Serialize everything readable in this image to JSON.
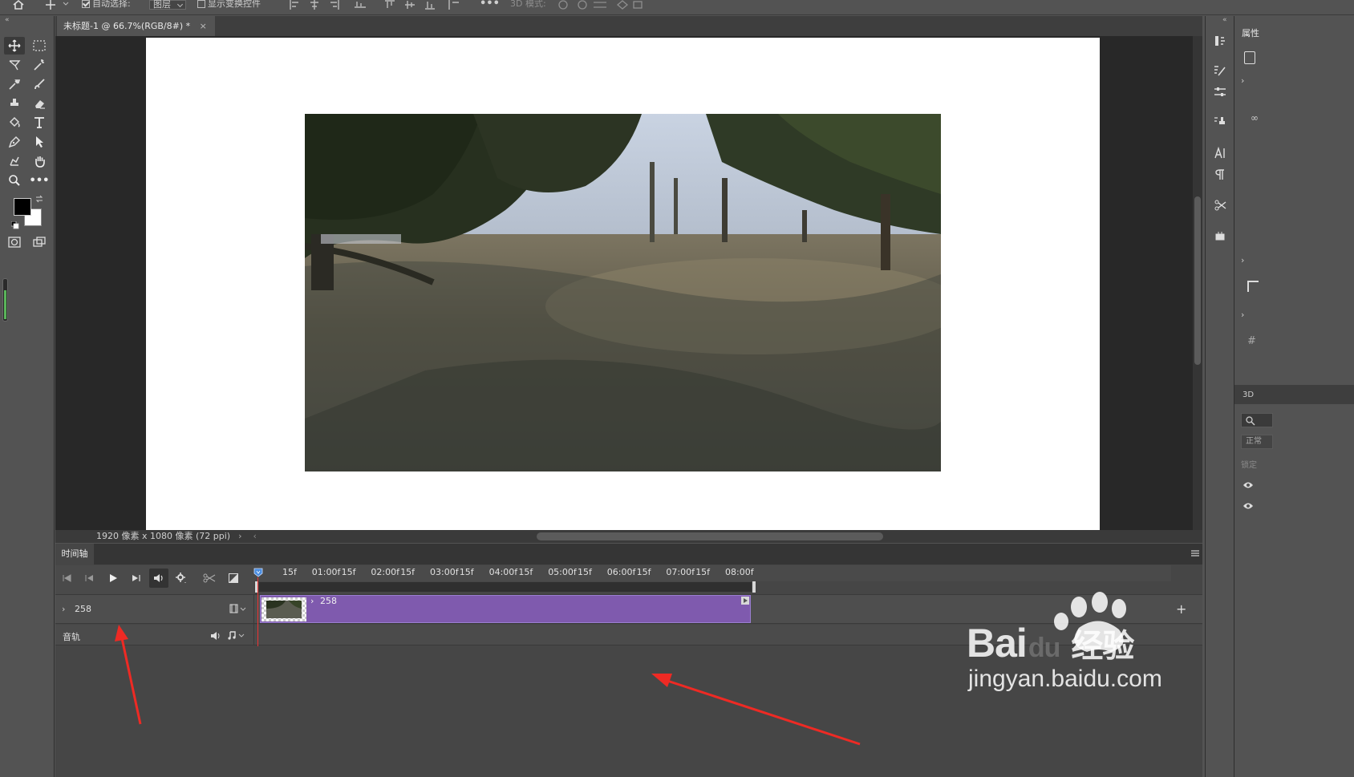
{
  "options_bar": {
    "auto_select_label": "自动选择:",
    "auto_select_target": "图层",
    "show_transform_label": "显示变换控件",
    "mode_3d_label": "3D 模式:"
  },
  "document": {
    "tab_title": "未标题-1 @ 66.7%(RGB/8#) *",
    "close_glyph": "×",
    "status": "1920 像素 x 1080 像素 (72 ppi)"
  },
  "timeline": {
    "panel_title": "时间轴",
    "ruler_ticks": [
      "15f",
      "01:00f",
      "15f",
      "02:00f",
      "15f",
      "03:00f",
      "15f",
      "04:00f",
      "15f",
      "05:00f",
      "15f",
      "06:00f",
      "15f",
      "07:00f",
      "15f",
      "08:00f"
    ],
    "video_track_name": "258",
    "clip_name": "258",
    "audio_track_name": "音轨",
    "add_glyph": "+"
  },
  "right_panel": {
    "properties_label": "属性",
    "label_3d": "3D",
    "blend_mode_fragment": "正常",
    "lock_fragment": "锁定"
  },
  "watermark": {
    "brand": "Bai",
    "brand_du": "du",
    "brand_cn": "经验",
    "url": "jingyan.baidu.com"
  },
  "colors": {
    "clip": "#7f5aae",
    "playhead": "#e33333",
    "annotation_arrow": "#ee2a24"
  }
}
